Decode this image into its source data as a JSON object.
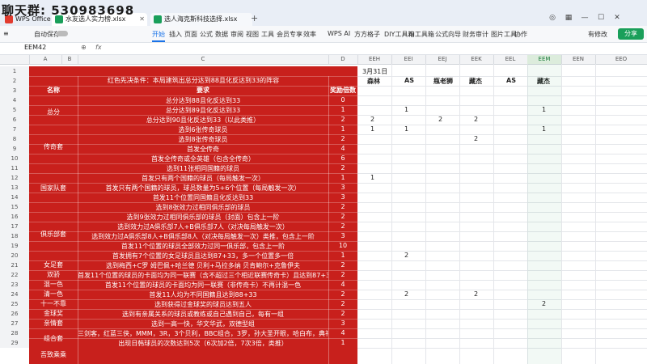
{
  "overlay": {
    "text": "聊天群: 530983698"
  },
  "tabs": [
    {
      "label": "WPS Office"
    },
    {
      "label": "水友选人实力榜.xlsx"
    },
    {
      "label": "选人海克斯科技选择.xlsx"
    }
  ],
  "ribbon": {
    "items": [
      "自动保存",
      "开始",
      "插入",
      "页面",
      "公式",
      "数据",
      "审阅",
      "视图",
      "工具",
      "会员专享",
      "效率",
      "WPS AI",
      "方方格子",
      "DIY工具箱",
      "AI工具箱",
      "公式向导",
      "财务审计",
      "图片工具",
      "协作"
    ],
    "active": "开始",
    "right": [
      "有修改",
      "分享"
    ]
  },
  "formula_bar": {
    "name_box": "EEM42",
    "fx": "fx",
    "value": ""
  },
  "columns": {
    "left": [
      "A",
      "B",
      "C",
      "D"
    ],
    "right": [
      "EEH",
      "EEI",
      "EEJ",
      "EEK",
      "EEL",
      "EEM",
      "EEN",
      "EEO"
    ],
    "selected": "EEM"
  },
  "row_numbers": [
    "1",
    "2",
    "3",
    "4",
    "5",
    "6",
    "7",
    "8",
    "9",
    "10",
    "11",
    "12",
    "13",
    "14",
    "15",
    "16",
    "17",
    "18",
    "19",
    "20",
    "21",
    "22",
    "23",
    "24",
    "25",
    "26",
    "27",
    "28",
    "29"
  ],
  "table": {
    "title": "红色先决条件：本局建筑出总分达到88且化反达到33的阵容",
    "header": {
      "col_b": "名称",
      "col_c": "要求",
      "col_d": "奖励倍数"
    },
    "rows": [
      {
        "req": "总分达到88且化反达到33",
        "mult": "0"
      },
      {
        "req": "总分达到89且化反达到33",
        "mult": "1"
      },
      {
        "req": "总分达到90且化反达到33（以此类推）",
        "mult": "2"
      },
      {
        "req": "选到6张传奇球员",
        "mult": "1"
      },
      {
        "req": "选到8张传奇球员",
        "mult": "2"
      },
      {
        "req": "首发全传奇",
        "mult": "4"
      },
      {
        "req": "首发全传奇或全英雄（包含全传奇）",
        "mult": "6"
      },
      {
        "req": "选到11张相同国籍的球员",
        "mult": "2"
      },
      {
        "req": "首发只有两个国籍的球员（每局触发一次）",
        "mult": "1"
      },
      {
        "req": "首发只有两个国籍的球员，球员数量为5+6个位置（每局触发一次）",
        "mult": "3"
      },
      {
        "req": "首发11个位置同国籍且化反达到33",
        "mult": "3"
      },
      {
        "req": "选到8张效力过相同俱乐部的球员",
        "mult": "2"
      },
      {
        "req": "选到9张效力过相同俱乐部的球员（封面）包含上一阶",
        "mult": "2"
      },
      {
        "req": "选到效力过A俱乐部7人+B俱乐部7人（对决每局触发一次）",
        "mult": "2"
      },
      {
        "req": "选到效力过A俱乐部8人+B俱乐部8人（对决每局触发一次）类推，包含上一阶",
        "mult": "3"
      },
      {
        "req": "首发11个位置的球员全部效力过同一俱乐部，包含上一阶",
        "mult": "10"
      },
      {
        "req": "首发拥有7个位置的女足球员且达到87+33，多一个位置多一倍",
        "mult": "1"
      },
      {
        "req": "选到梅西+C罗 姆巴佩+哈兰德 贝利+马拉多纳 贝肯鲍尔+克鲁伊夫",
        "mult": "2"
      },
      {
        "req": "首发11个位置的球员的卡面均为同一联赛（含不超过三个相近联赛传奇卡）且达到87+33",
        "mult": "2"
      },
      {
        "req": "首发11个位置的球员的卡面均为同一联赛（非传奇卡）不再计混一色",
        "mult": "4"
      },
      {
        "req": "首发11人均为不同国籍且达到88+33",
        "mult": "2"
      },
      {
        "req": "选到获得过金球奖的球员达到五人",
        "mult": "2"
      },
      {
        "req": "选到有亲属关系的球员或教练或自己遇到自己，每有一组",
        "mult": "2"
      },
      {
        "req": "选到一高一快，华文华武，双德型组",
        "mult": "3"
      },
      {
        "req": "三剑客，红蓝三侠，MMM，3R，3个贝利，BBC组合，3罗，孙大圣开眼，哈白布，典礼/费礼",
        "mult": "4"
      },
      {
        "req": "出现日韩球员的次数达到5次（6次加2倍，7次3倍，类推）",
        "mult": "1"
      }
    ],
    "names": [
      "总分",
      "传奇套",
      "国家队套",
      "俱乐部套",
      "女足套",
      "双骄",
      "混一色",
      "清一色",
      "十一不靠",
      "金球奖",
      "亲情套",
      "组合套",
      "吾致乘乘"
    ]
  },
  "right_grid": {
    "date": "3月31日",
    "players": [
      "森林",
      "AS",
      "瓶老狮",
      "藏杰",
      "AS",
      "藏杰"
    ],
    "cells": [
      {
        "row": 5,
        "col": 1,
        "v": "1"
      },
      {
        "row": 5,
        "col": 5,
        "v": "1"
      },
      {
        "row": 6,
        "col": 0,
        "v": "2"
      },
      {
        "row": 6,
        "col": 2,
        "v": "2"
      },
      {
        "row": 6,
        "col": 3,
        "v": "2"
      },
      {
        "row": 7,
        "col": 0,
        "v": "1"
      },
      {
        "row": 7,
        "col": 1,
        "v": "1"
      },
      {
        "row": 7,
        "col": 5,
        "v": "1"
      },
      {
        "row": 8,
        "col": 3,
        "v": "2"
      },
      {
        "row": 12,
        "col": 0,
        "v": "1"
      },
      {
        "row": 20,
        "col": 1,
        "v": "2"
      },
      {
        "row": 24,
        "col": 1,
        "v": "2"
      },
      {
        "row": 24,
        "col": 3,
        "v": "2"
      },
      {
        "row": 25,
        "col": 5,
        "v": "2"
      }
    ]
  }
}
